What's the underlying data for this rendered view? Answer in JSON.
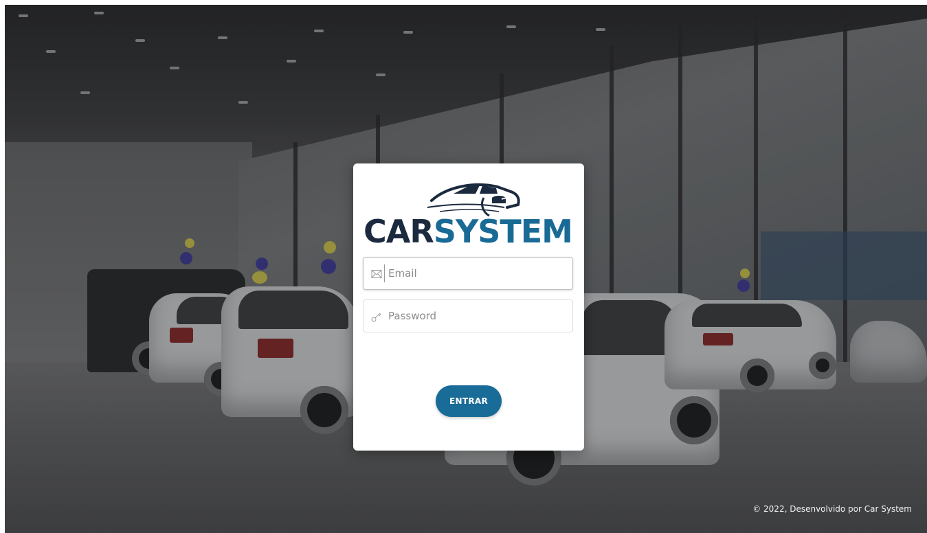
{
  "login": {
    "logo_text_part1": "CAR",
    "logo_text_part2": "SYSTEM",
    "email": {
      "placeholder": "Email",
      "value": ""
    },
    "password": {
      "placeholder": "Password",
      "value": ""
    },
    "submit_label": "ENTRAR"
  },
  "footer": {
    "copyright": "© 2022, Desenvolvido por Car System"
  },
  "colors": {
    "brand_dark": "#1b2a3e",
    "brand_blue": "#1a6a96",
    "button": "#196b98"
  },
  "icons": {
    "email": "envelope-icon",
    "password": "key-icon",
    "logo": "car-logo-icon"
  }
}
